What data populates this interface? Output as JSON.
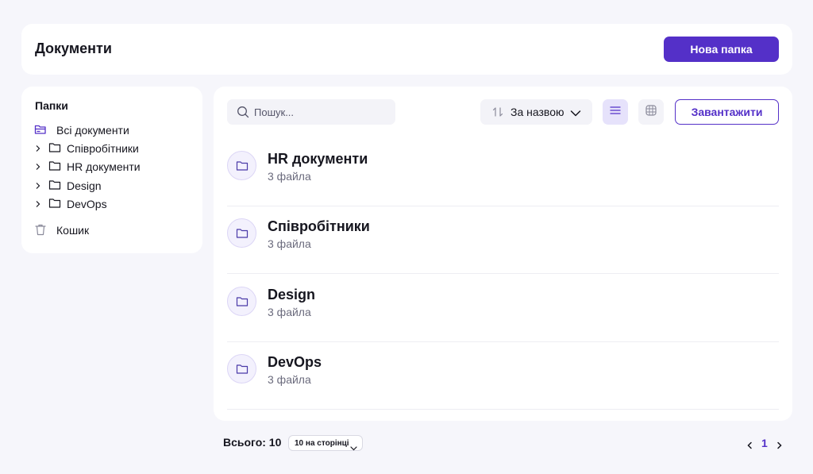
{
  "header": {
    "title": "Документи",
    "new_folder_label": "Нова папка"
  },
  "sidebar": {
    "title": "Папки",
    "root_label": "Всі документи",
    "folders": [
      "Співробітники",
      "HR документи",
      "Design",
      "DevOps"
    ],
    "trash_label": "Кошик"
  },
  "toolbar": {
    "search_placeholder": "Пошук...",
    "sort_label": "За назвою",
    "upload_label": "Завантажити",
    "active_view": "list"
  },
  "folders": [
    {
      "name": "HR документи",
      "count": "3 файла"
    },
    {
      "name": "Співробітники",
      "count": "3 файла"
    },
    {
      "name": "Design",
      "count": "3 файла"
    },
    {
      "name": "DevOps",
      "count": "3 файла"
    }
  ],
  "footer": {
    "total": "Всього: 10",
    "per_page": "10 на сторінці",
    "current_page": "1"
  },
  "colors": {
    "accent": "#5430c8",
    "background": "#f6f6fb",
    "panel": "#ffffff"
  }
}
